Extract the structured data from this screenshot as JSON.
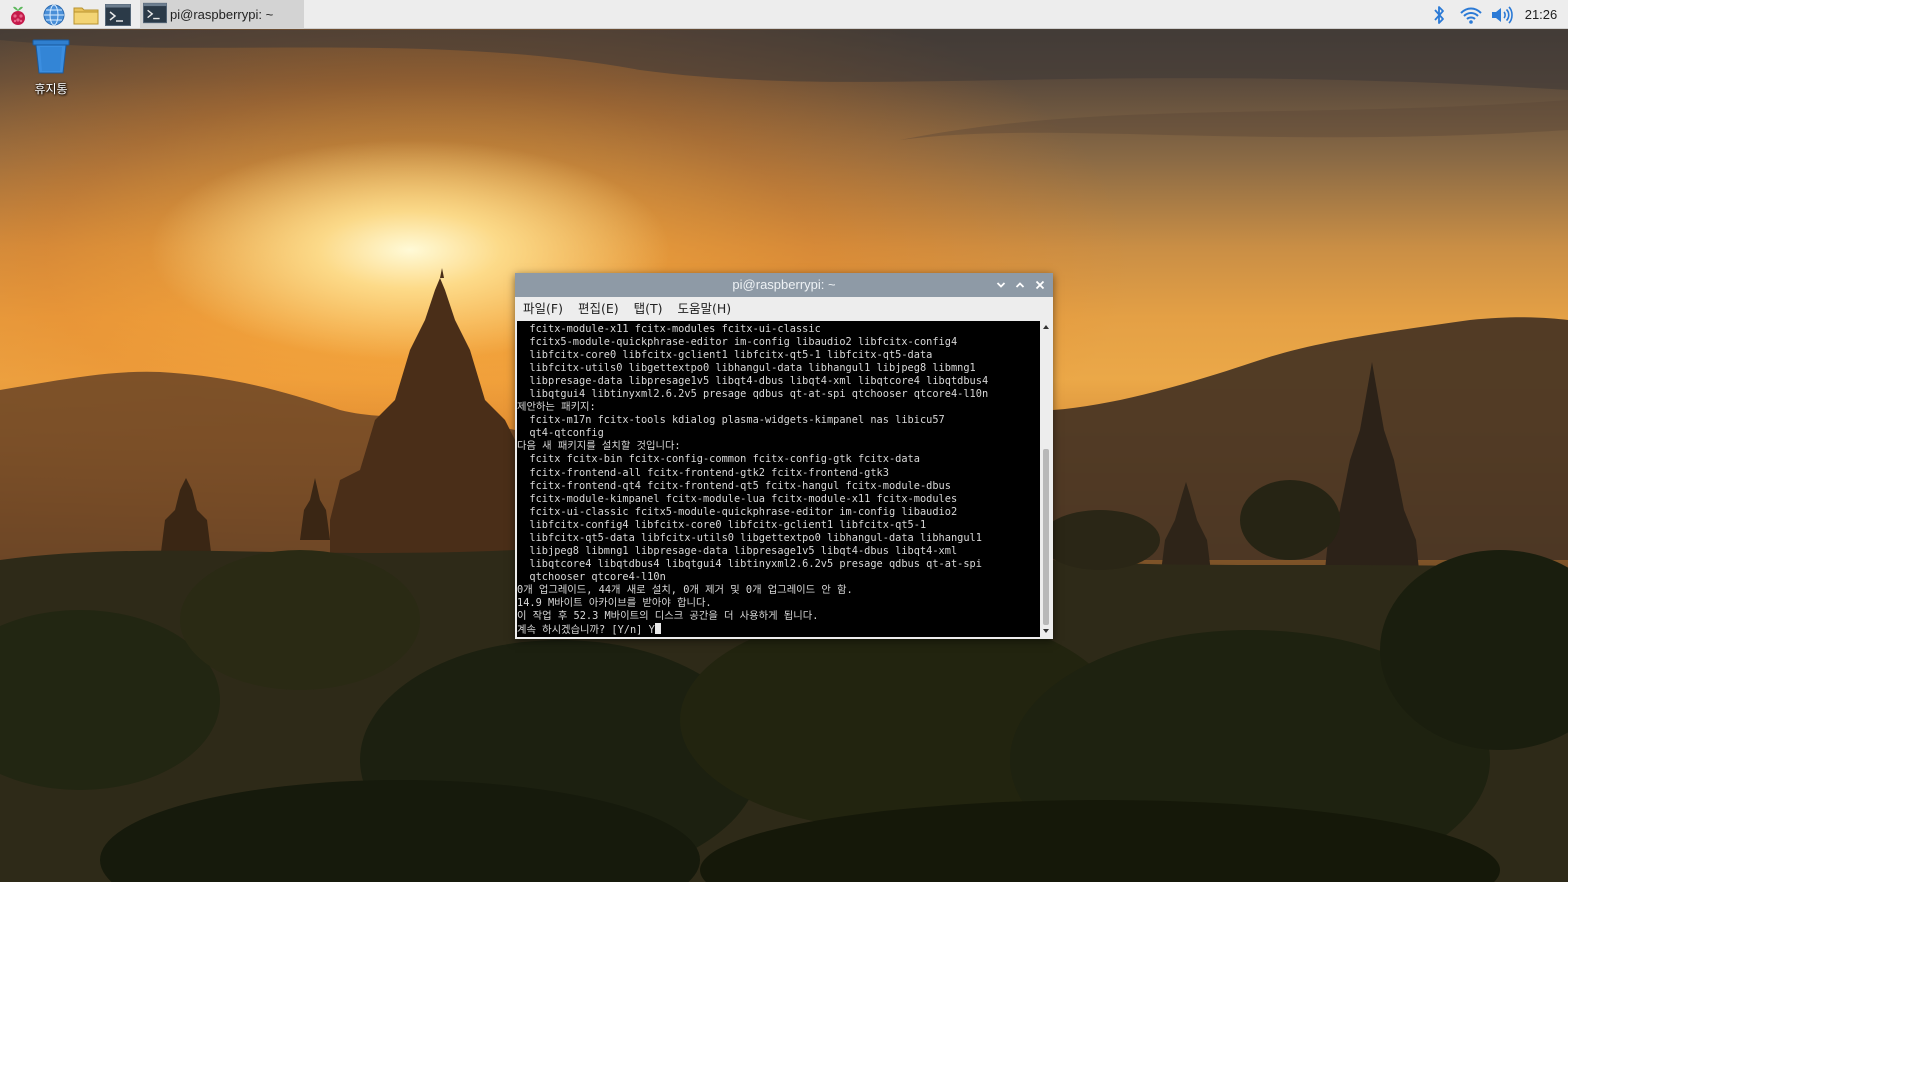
{
  "panel": {
    "launchers": [
      {
        "name": "raspberry-menu-icon"
      },
      {
        "name": "web-browser-icon"
      },
      {
        "name": "file-manager-icon"
      },
      {
        "name": "terminal-icon"
      }
    ],
    "task": {
      "label": "pi@raspberrypi: ~",
      "icon": "terminal-icon"
    },
    "tray": {
      "icons": [
        "bluetooth-icon",
        "wifi-icon",
        "volume-icon"
      ],
      "clock": "21:26"
    }
  },
  "desktop": {
    "trash_label": "휴지통"
  },
  "terminal": {
    "title": "pi@raspberrypi: ~",
    "menu": [
      "파일(F)",
      "편집(E)",
      "탭(T)",
      "도움말(H)"
    ],
    "lines": [
      "  fcitx-module-x11 fcitx-modules fcitx-ui-classic",
      "  fcitx5-module-quickphrase-editor im-config libaudio2 libfcitx-config4",
      "  libfcitx-core0 libfcitx-gclient1 libfcitx-qt5-1 libfcitx-qt5-data",
      "  libfcitx-utils0 libgettextpo0 libhangul-data libhangul1 libjpeg8 libmng1",
      "  libpresage-data libpresage1v5 libqt4-dbus libqt4-xml libqtcore4 libqtdbus4",
      "  libqtgui4 libtinyxml2.6.2v5 presage qdbus qt-at-spi qtchooser qtcore4-l10n",
      "제안하는 패키지:",
      "  fcitx-m17n fcitx-tools kdialog plasma-widgets-kimpanel nas libicu57",
      "  qt4-qtconfig",
      "다음 새 패키지를 설치할 것입니다:",
      "  fcitx fcitx-bin fcitx-config-common fcitx-config-gtk fcitx-data",
      "  fcitx-frontend-all fcitx-frontend-gtk2 fcitx-frontend-gtk3",
      "  fcitx-frontend-qt4 fcitx-frontend-qt5 fcitx-hangul fcitx-module-dbus",
      "  fcitx-module-kimpanel fcitx-module-lua fcitx-module-x11 fcitx-modules",
      "  fcitx-ui-classic fcitx5-module-quickphrase-editor im-config libaudio2",
      "  libfcitx-config4 libfcitx-core0 libfcitx-gclient1 libfcitx-qt5-1",
      "  libfcitx-qt5-data libfcitx-utils0 libgettextpo0 libhangul-data libhangul1",
      "  libjpeg8 libmng1 libpresage-data libpresage1v5 libqt4-dbus libqt4-xml",
      "  libqtcore4 libqtdbus4 libqtgui4 libtinyxml2.6.2v5 presage qdbus qt-at-spi",
      "  qtchooser qtcore4-l10n",
      "0개 업그레이드, 44개 새로 설치, 0개 제거 및 0개 업그레이드 안 함.",
      "14.9 M바이트 아카이브를 받아야 합니다.",
      "이 작업 후 52.3 M바이트의 디스크 공간을 더 사용하게 됩니다."
    ],
    "prompt": "계속 하시겠습니까? [Y/n] Y"
  }
}
